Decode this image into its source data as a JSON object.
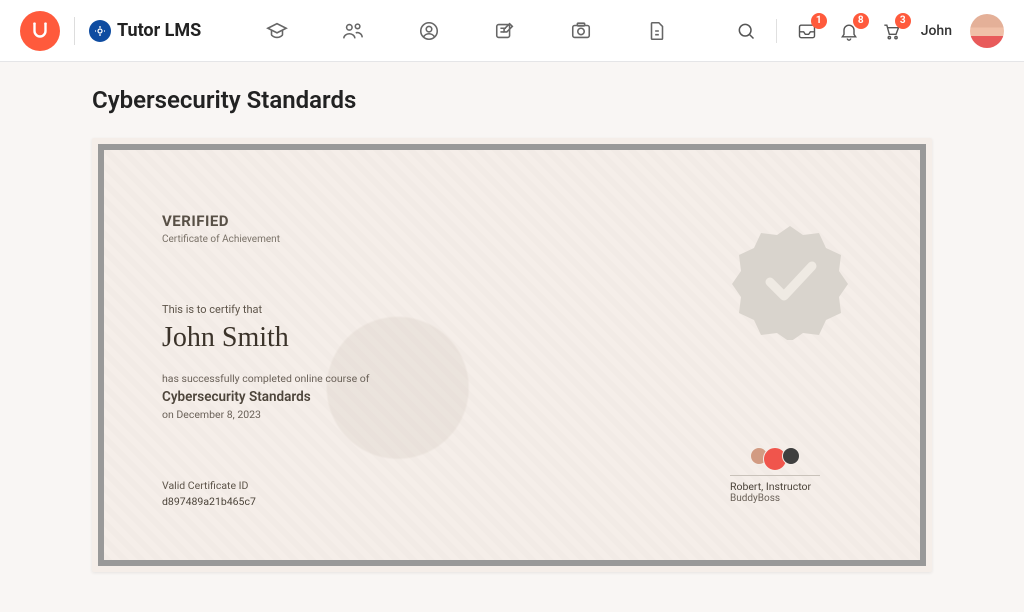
{
  "brand": {
    "name": "Tutor LMS"
  },
  "header_badges": {
    "inbox": "1",
    "bell": "8",
    "cart": "3"
  },
  "user": {
    "display_name": "John"
  },
  "page": {
    "title": "Cybersecurity Standards"
  },
  "certificate": {
    "verified_label": "VERIFIED",
    "achievement_label": "Certificate of Achievement",
    "certify_line": "This is to certify that",
    "recipient": "John Smith",
    "completed_line": "has successfully completed online course of",
    "course_name": "Cybersecurity Standards",
    "date_line": "on December 8, 2023",
    "valid_id_label": "Valid Certificate ID",
    "certificate_id": "d897489a21b465c7",
    "instructor_name": "Robert, Instructor",
    "instructor_org": "BuddyBoss"
  }
}
